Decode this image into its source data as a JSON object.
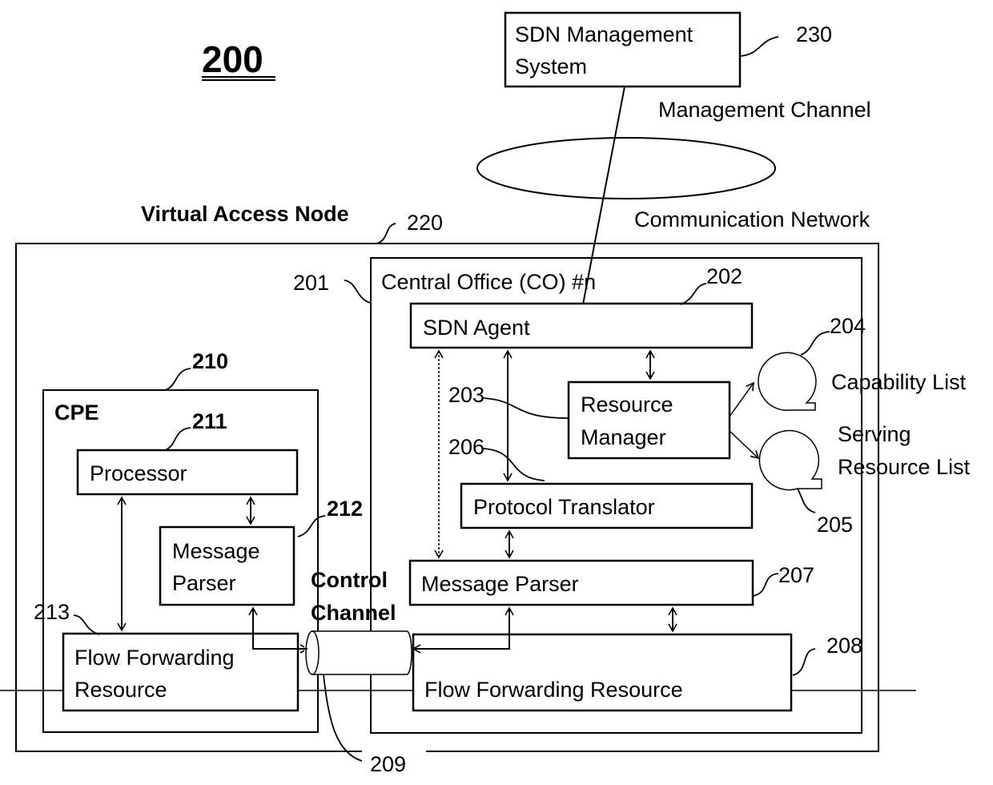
{
  "figure": {
    "number": "200"
  },
  "sdn_management_system": {
    "label_line1": "SDN Management",
    "label_line2": "System",
    "ref": "230"
  },
  "management_channel": {
    "label": "Management Channel"
  },
  "communication_network": {
    "label": "Communication Network"
  },
  "virtual_access_node": {
    "label": "Virtual Access Node",
    "ref": "220"
  },
  "central_office": {
    "label": "Central Office (CO) #n",
    "ref": "201",
    "sdn_agent": {
      "label": "SDN Agent",
      "ref": "202"
    },
    "resource_manager": {
      "label_line1": "Resource",
      "label_line2": "Manager",
      "ref": "203"
    },
    "capability_list": {
      "label": "Capability List",
      "ref": "204"
    },
    "serving_resource_list": {
      "label_line1": "Serving",
      "label_line2": "Resource List",
      "ref": "205"
    },
    "protocol_translator": {
      "label": "Protocol Translator",
      "ref": "206"
    },
    "message_parser": {
      "label": "Message Parser",
      "ref": "207"
    },
    "flow_forwarding_resource": {
      "label": "Flow Forwarding Resource",
      "ref": "208"
    }
  },
  "control_channel": {
    "label_line1": "Control",
    "label_line2": "Channel",
    "ref": "209"
  },
  "cpe": {
    "label": "CPE",
    "ref": "210",
    "processor": {
      "label": "Processor",
      "ref": "211"
    },
    "message_parser": {
      "label_line1": "Message",
      "label_line2": "Parser",
      "ref": "212"
    },
    "flow_forwarding_resource": {
      "label_line1": "Flow Forwarding",
      "label_line2": "Resource",
      "ref": "213"
    }
  }
}
